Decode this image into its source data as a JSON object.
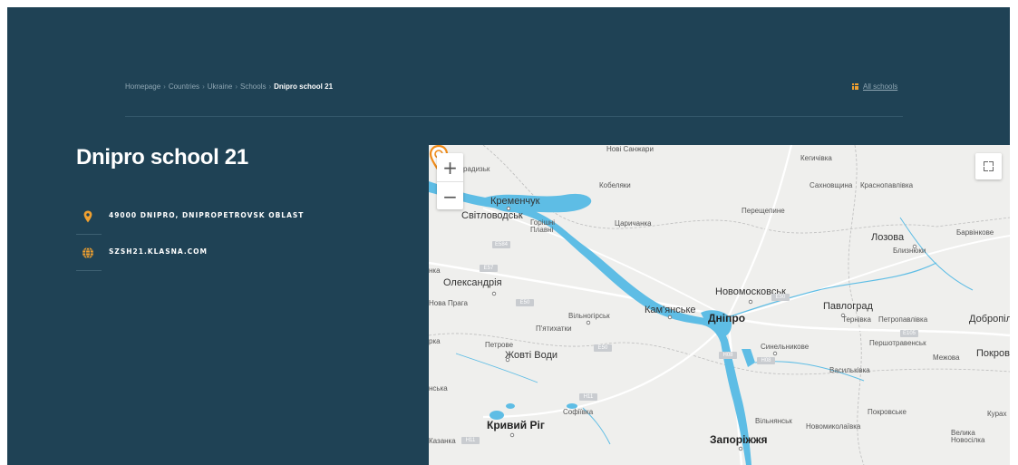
{
  "breadcrumb": {
    "items": [
      "Homepage",
      "Countries",
      "Ukraine",
      "Schools"
    ],
    "current": "Dnipro school 21"
  },
  "all_schools_label": "All schools",
  "school": {
    "title": "Dnipro school 21",
    "address": "49000 DNIPRO, DNIPROPETROVSK OBLAST",
    "website": "SZSH21.KLASNA.COM"
  },
  "colors": {
    "background": "#1f4255",
    "accent": "#f0a030",
    "water": "#5ebde5"
  },
  "map": {
    "zoom_in": "+",
    "zoom_out": "−",
    "labels": {
      "nova_sanzhary": "Нові Санжари",
      "kehychivka": "Кегичівка",
      "hradyzk": "радизьк",
      "kobeliaky": "Кобеляки",
      "sakhnovshchyna": "Сахновщина",
      "krasnopavlivka": "Краснопавлівка",
      "kremenchuk": "Кременчук",
      "svitlovodsk": "Світловодськ",
      "horishni_plavni": "Горішні Плавні",
      "tsarychanka": "Царичанка",
      "pereshchepyne": "Перещепине",
      "lozova": "Лозова",
      "barvinkove": "Барвінкове",
      "blyzniuky": "Близнюки",
      "oleksandriia": "Олександрія",
      "nka": "нка",
      "novomoskovsk": "Новомосковськ",
      "nova_praha": "Нова Прага",
      "pavlohrad": "Павлоград",
      "kamianske": "Кам'янське",
      "vilnohirsk": "Вільногірськ",
      "dnipro": "Дніпро",
      "ternivka": "Тернівка",
      "petropavlivka": "Петропавлівка",
      "dobropillia": "Добропілля",
      "piatykhatky": "П'ятихатки",
      "petrove": "Петрове",
      "zhovti_vody": "Жовті Води",
      "synelnykove": "Синельникове",
      "pershotravensk": "Першотравенськ",
      "mezhova": "Межова",
      "pokrovsk": "Покровсь",
      "vasylkivka": "Васильківка",
      "rka": "рка",
      "nska": "нська",
      "sofiivka": "Софіївка",
      "pokrovske": "Покровське",
      "vilniansk": "Вільнянськ",
      "novomykolaivka": "Новомиколаївка",
      "kurakhove": "Курах",
      "kryvyi_rih": "Кривий Ріг",
      "zaporizhzhia": "Запоріжжя",
      "velyka_novosilka": "Велика Новосілка",
      "kazanka": "Казанка"
    },
    "shields": [
      "E584",
      "E57",
      "E50",
      "E50",
      "E50",
      "H08",
      "H08",
      "E105",
      "H11",
      "H11"
    ]
  }
}
